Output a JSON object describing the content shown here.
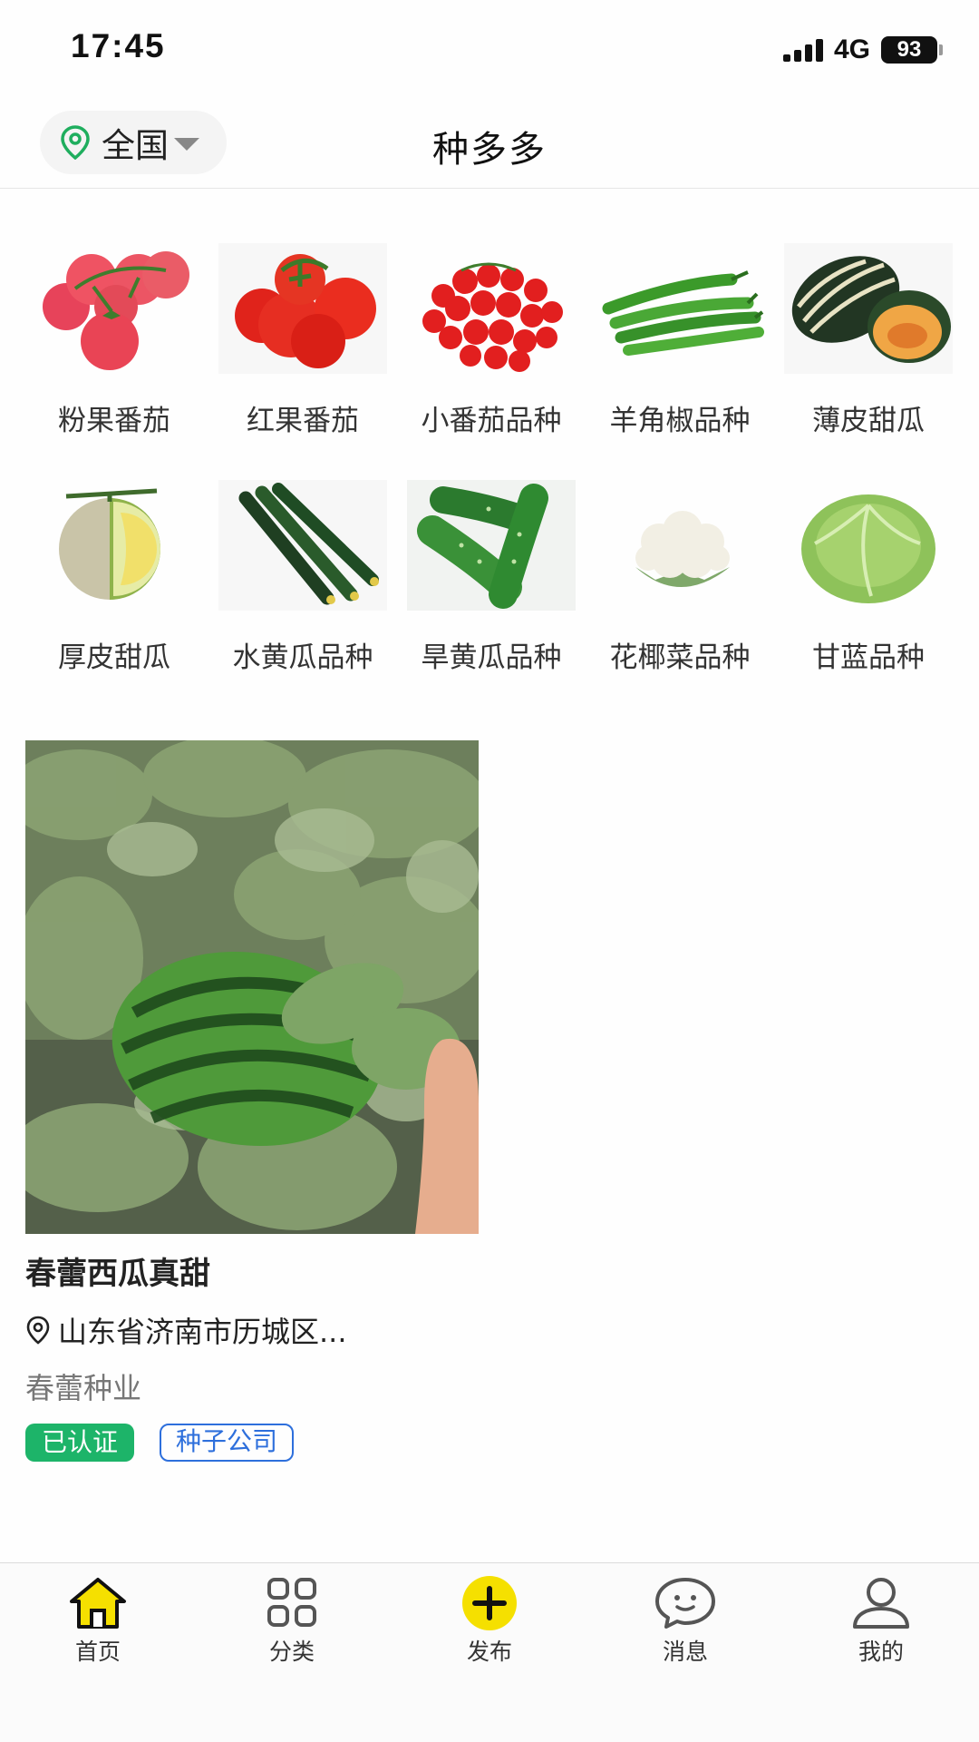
{
  "status_bar": {
    "time": "17:45",
    "network": "4G",
    "battery": "93"
  },
  "header": {
    "location": "全国",
    "title": "种多多"
  },
  "categories": [
    {
      "label": "粉果番茄",
      "icon": "pink-tomato"
    },
    {
      "label": "红果番茄",
      "icon": "red-tomato"
    },
    {
      "label": "小番茄品种",
      "icon": "cherry-tomato"
    },
    {
      "label": "羊角椒品种",
      "icon": "green-pepper"
    },
    {
      "label": "薄皮甜瓜",
      "icon": "thin-skin-melon"
    },
    {
      "label": "厚皮甜瓜",
      "icon": "thick-skin-melon"
    },
    {
      "label": "水黄瓜品种",
      "icon": "water-cucumber"
    },
    {
      "label": "旱黄瓜品种",
      "icon": "dry-cucumber"
    },
    {
      "label": "花椰菜品种",
      "icon": "cauliflower"
    },
    {
      "label": "甘蓝品种",
      "icon": "cabbage"
    }
  ],
  "product": {
    "title": "春蕾西瓜真甜",
    "location": "山东省济南市历城区...",
    "company": "春蕾种业",
    "tags": {
      "verified": "已认证",
      "type": "种子公司"
    },
    "photo": "watermelon-field-photo"
  },
  "tabbar": {
    "items": [
      {
        "label": "首页",
        "icon": "home-icon"
      },
      {
        "label": "分类",
        "icon": "grid-icon"
      },
      {
        "label": "发布",
        "icon": "plus-icon"
      },
      {
        "label": "消息",
        "icon": "chat-icon"
      },
      {
        "label": "我的",
        "icon": "user-icon"
      }
    ],
    "accent": "#f5e000"
  }
}
